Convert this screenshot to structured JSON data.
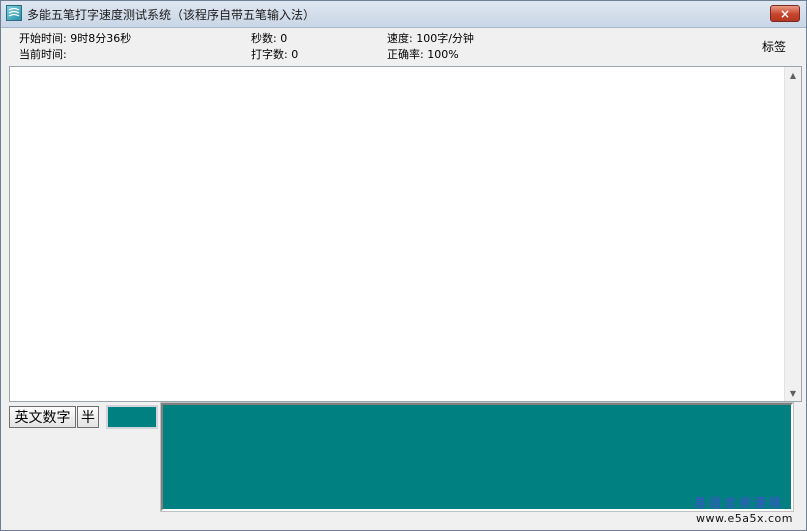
{
  "window": {
    "title": "多能五笔打字速度测试系统（该程序自带五笔输入法）",
    "close_label": "×"
  },
  "stats": {
    "start_time": "开始时间: 9时8分36秒",
    "current_time": "当前时间:",
    "seconds": "秒数: 0",
    "typed_count": "打字数: 0",
    "speed": "速度: 100字/分钟",
    "accuracy": "正确率: 100%",
    "tag_label": "标签"
  },
  "ime": {
    "mode_label": "英文数字",
    "width_label": "半"
  },
  "colors": {
    "teal": "#008080",
    "close_red": "#c8432b"
  },
  "watermark": {
    "cn": "易语言资源网",
    "url": "www.e5a5x.com"
  }
}
